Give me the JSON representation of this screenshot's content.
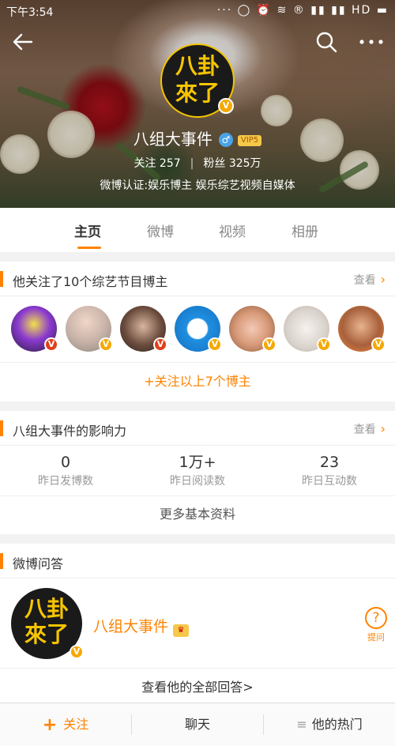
{
  "status_bar": {
    "time": "下午3:54",
    "icons_text": "··· ◯ ⏰ ≋ ® ▮▮ ▮▮ HD ▬"
  },
  "header": {
    "avatar_text_line1": "八卦",
    "avatar_text_line2": "來了",
    "name": "八组大事件",
    "gender_symbol": "♂",
    "vip_label": "VIP5",
    "following_label": "关注",
    "following_count": "257",
    "followers_label": "粉丝",
    "followers_count": "325万",
    "verification": "微博认证:娱乐博主 娱乐综艺视频自媒体"
  },
  "tabs": [
    {
      "label": "主页",
      "active": true
    },
    {
      "label": "微博",
      "active": false
    },
    {
      "label": "视频",
      "active": false
    },
    {
      "label": "相册",
      "active": false
    }
  ],
  "following_card": {
    "title": "他关注了10个综艺节目博主",
    "more_label": "查看",
    "avatars": [
      {
        "name": "avatar-1",
        "badge": "red"
      },
      {
        "name": "avatar-2",
        "badge": "yellow"
      },
      {
        "name": "avatar-3",
        "badge": "red"
      },
      {
        "name": "avatar-4",
        "badge": "yellow"
      },
      {
        "name": "avatar-5",
        "badge": "yellow"
      },
      {
        "name": "avatar-6",
        "badge": "yellow"
      },
      {
        "name": "avatar-7",
        "badge": "yellow"
      }
    ],
    "follow_all_label": "+关注以上7个博主"
  },
  "influence_card": {
    "title": "八组大事件的影响力",
    "more_label": "查看",
    "stats": [
      {
        "value": "0",
        "label": "昨日发博数"
      },
      {
        "value": "1万+",
        "label": "昨日阅读数"
      },
      {
        "value": "23",
        "label": "昨日互动数"
      }
    ],
    "more_info_label": "更多基本资料"
  },
  "qa_card": {
    "title": "微博问答",
    "name": "八组大事件",
    "crown_symbol": "♛",
    "ask_symbol": "?",
    "ask_label": "提问",
    "all_answers_label": "查看他的全部回答>"
  },
  "bottom_bar": {
    "follow_label": "关注",
    "follow_symbol": "+",
    "chat_label": "聊天",
    "hot_symbol": "≡",
    "hot_label": "他的热门"
  },
  "colors": {
    "accent": "#ff8200",
    "verified_gold": "#f6a800",
    "verified_red": "#e0401a"
  }
}
